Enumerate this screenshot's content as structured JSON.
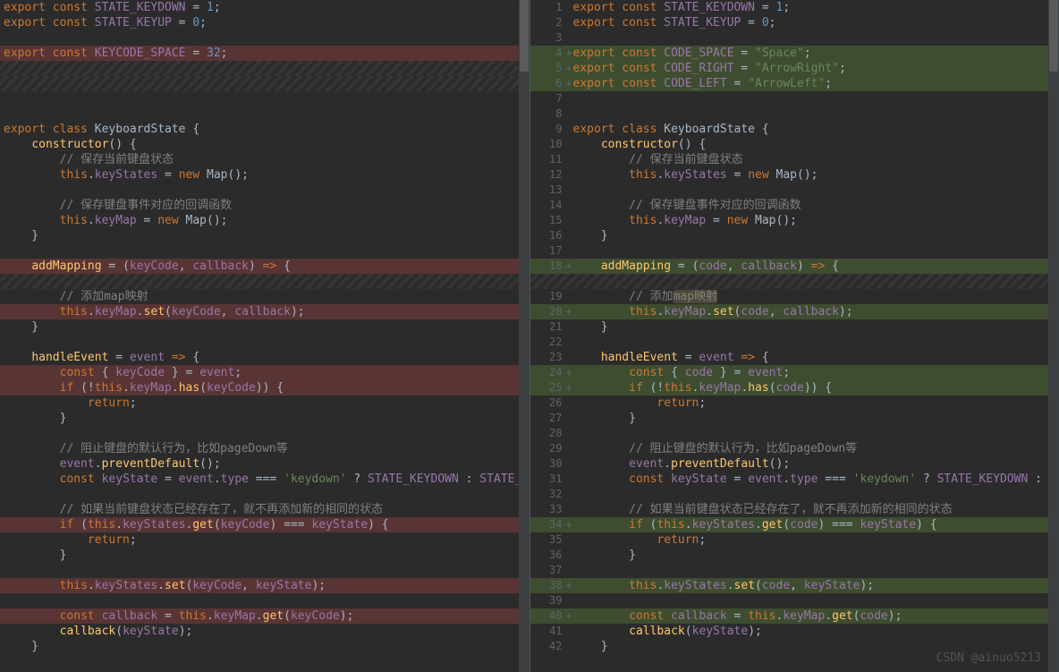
{
  "watermark": "CSDN @ainuo5213",
  "left": {
    "lines": [
      {
        "cls": "",
        "html": "<span class='kw'>export</span> <span class='kw'>const</span> <span class='prop'>STATE_KEYDOWN</span> = <span class='num'>1</span>;"
      },
      {
        "cls": "",
        "html": "<span class='kw'>export</span> <span class='kw'>const</span> <span class='prop'>STATE_KEYUP</span> = <span class='num'>0</span>;"
      },
      {
        "cls": "",
        "html": ""
      },
      {
        "cls": "del",
        "html": "<span class='kw'>export</span> <span class='kw'>const</span> <span class='prop'>KEYCODE_SPACE</span> = <span class='num'>32</span>;"
      },
      {
        "cls": "hatch",
        "html": ""
      },
      {
        "cls": "hatch",
        "html": ""
      },
      {
        "cls": "",
        "html": ""
      },
      {
        "cls": "",
        "html": ""
      },
      {
        "cls": "",
        "html": "<span class='kw'>export</span> <span class='kw'>class</span> <span class='cls'>KeyboardState</span> {"
      },
      {
        "cls": "",
        "html": "    <span class='fn'>constructor</span>() {"
      },
      {
        "cls": "",
        "html": "        <span class='cmt'>// 保存当前键盘状态</span>"
      },
      {
        "cls": "",
        "html": "        <span class='this'>this</span>.<span class='prop'>keyStates</span> = <span class='new'>new</span> Map();"
      },
      {
        "cls": "",
        "html": ""
      },
      {
        "cls": "",
        "html": "        <span class='cmt'>// 保存键盘事件对应的回调函数</span>"
      },
      {
        "cls": "",
        "html": "        <span class='this'>this</span>.<span class='prop'>keyMap</span> = <span class='new'>new</span> Map();"
      },
      {
        "cls": "",
        "html": "    }"
      },
      {
        "cls": "",
        "html": ""
      },
      {
        "cls": "del",
        "html": "    <span class='fn'>addMapping</span> = (<span class='prop'>keyCode</span>, <span class='prop'>callback</span>) <span class='kw'>=&gt;</span> {"
      },
      {
        "cls": "hatch",
        "html": ""
      },
      {
        "cls": "",
        "html": "        <span class='cmt'>// 添加map映射</span>"
      },
      {
        "cls": "del",
        "html": "        <span class='this'>this</span>.<span class='prop'>keyMap</span>.<span class='fn'>set</span>(<span class='prop'>keyCode</span>, <span class='prop'>callback</span>);"
      },
      {
        "cls": "",
        "html": "    }"
      },
      {
        "cls": "",
        "html": ""
      },
      {
        "cls": "",
        "html": "    <span class='fn'>handleEvent</span> = <span class='prop'>event</span> <span class='kw'>=&gt;</span> {"
      },
      {
        "cls": "del",
        "html": "        <span class='kw'>const</span> { <span class='prop'>keyCode</span> } = <span class='prop'>event</span>;"
      },
      {
        "cls": "del",
        "html": "        <span class='kw'>if</span> (!<span class='this'>this</span>.<span class='prop'>keyMap</span>.<span class='fn'>has</span>(<span class='prop'>keyCode</span>)) {"
      },
      {
        "cls": "",
        "html": "            <span class='kw'>return</span>;"
      },
      {
        "cls": "",
        "html": "        }"
      },
      {
        "cls": "",
        "html": ""
      },
      {
        "cls": "",
        "html": "        <span class='cmt'>// 阻止键盘的默认行为，比如pageDown等</span>"
      },
      {
        "cls": "",
        "html": "        <span class='prop'>event</span>.<span class='fn'>preventDefault</span>();"
      },
      {
        "cls": "",
        "html": "        <span class='kw'>const</span> <span class='prop'>keyState</span> = <span class='prop'>event</span>.<span class='prop'>type</span> === <span class='str'>'keydown'</span> ? <span class='prop'>STATE_KEYDOWN</span> : <span class='prop'>STATE_</span>"
      },
      {
        "cls": "",
        "html": ""
      },
      {
        "cls": "",
        "html": "        <span class='cmt'>// 如果当前键盘状态已经存在了，就不再添加新的相同的状态</span>"
      },
      {
        "cls": "del",
        "html": "        <span class='kw'>if</span> (<span class='this'>this</span>.<span class='prop'>keyStates</span>.<span class='fn'>get</span>(<span class='prop'>keyCode</span>) === <span class='prop'>keyState</span>) {"
      },
      {
        "cls": "",
        "html": "            <span class='kw'>return</span>;"
      },
      {
        "cls": "",
        "html": "        }"
      },
      {
        "cls": "",
        "html": ""
      },
      {
        "cls": "del",
        "html": "        <span class='this'>this</span>.<span class='prop'>keyStates</span>.<span class='fn'>set</span>(<span class='prop'>keyCode</span>, <span class='prop'>keyState</span>);"
      },
      {
        "cls": "",
        "html": ""
      },
      {
        "cls": "del",
        "html": "        <span class='kw'>const</span> <span class='prop'>callback</span> = <span class='this'>this</span>.<span class='prop'>keyMap</span>.<span class='fn'>get</span>(<span class='prop'>keyCode</span>);"
      },
      {
        "cls": "",
        "html": "        <span class='fn'>callback</span>(<span class='prop'>keyState</span>);"
      },
      {
        "cls": "",
        "html": "    }"
      }
    ]
  },
  "right": {
    "lines": [
      {
        "num": "1",
        "plus": false,
        "cls": "",
        "html": "<span class='kw'>export</span> <span class='kw'>const</span> <span class='prop'>STATE_KEYDOWN</span> = <span class='num'>1</span>;"
      },
      {
        "num": "2",
        "plus": false,
        "cls": "",
        "html": "<span class='kw'>export</span> <span class='kw'>const</span> <span class='prop'>STATE_KEYUP</span> = <span class='num'>0</span>;"
      },
      {
        "num": "3",
        "plus": false,
        "cls": "",
        "html": ""
      },
      {
        "num": "4",
        "plus": true,
        "cls": "add",
        "html": "<span class='kw'>export</span> <span class='kw'>const</span> <span class='prop'>CODE_SPACE</span> = <span class='str'>\"Space\"</span>;"
      },
      {
        "num": "5",
        "plus": true,
        "cls": "add",
        "html": "<span class='kw'>export</span> <span class='kw'>const</span> <span class='prop'>CODE_RIGHT</span> = <span class='str'>\"ArrowRight\"</span>;"
      },
      {
        "num": "6",
        "plus": true,
        "cls": "add",
        "html": "<span class='kw'>export</span> <span class='kw'>const</span> <span class='prop'>CODE_LEFT</span> = <span class='str'>\"ArrowLeft\"</span>;"
      },
      {
        "num": "7",
        "plus": false,
        "cls": "",
        "html": ""
      },
      {
        "num": "8",
        "plus": false,
        "cls": "",
        "html": ""
      },
      {
        "num": "9",
        "plus": false,
        "cls": "",
        "html": "<span class='kw'>export</span> <span class='kw'>class</span> <span class='cls'>KeyboardState</span> {"
      },
      {
        "num": "10",
        "plus": false,
        "cls": "",
        "html": "    <span class='fn'>constructor</span>() {"
      },
      {
        "num": "11",
        "plus": false,
        "cls": "",
        "html": "        <span class='cmt'>// 保存当前键盘状态</span>"
      },
      {
        "num": "12",
        "plus": false,
        "cls": "",
        "html": "        <span class='this'>this</span>.<span class='prop'>keyStates</span> = <span class='new'>new</span> Map();"
      },
      {
        "num": "13",
        "plus": false,
        "cls": "",
        "html": ""
      },
      {
        "num": "14",
        "plus": false,
        "cls": "",
        "html": "        <span class='cmt'>// 保存键盘事件对应的回调函数</span>"
      },
      {
        "num": "15",
        "plus": false,
        "cls": "",
        "html": "        <span class='this'>this</span>.<span class='prop'>keyMap</span> = <span class='new'>new</span> Map();"
      },
      {
        "num": "16",
        "plus": false,
        "cls": "",
        "html": "    }"
      },
      {
        "num": "17",
        "plus": false,
        "cls": "",
        "html": ""
      },
      {
        "num": "18",
        "plus": true,
        "cls": "add",
        "html": "    <span class='fn'>addMapping</span> = (<span class='prop'>code</span>, <span class='prop'>callback</span>) <span class='kw'>=&gt;</span> {"
      },
      {
        "num": "",
        "plus": false,
        "cls": "hatch",
        "html": ""
      },
      {
        "num": "19",
        "plus": false,
        "cls": "",
        "html": "        <span class='cmt'>// 添加<span class='hl-word'>map映射</span></span>"
      },
      {
        "num": "20",
        "plus": true,
        "cls": "add",
        "html": "        <span class='this'>this</span>.<span class='prop'>keyMap</span>.<span class='fn'>set</span>(<span class='prop'>code</span>, <span class='prop'>callback</span>);"
      },
      {
        "num": "21",
        "plus": false,
        "cls": "",
        "html": "    }"
      },
      {
        "num": "22",
        "plus": false,
        "cls": "",
        "html": ""
      },
      {
        "num": "23",
        "plus": false,
        "cls": "",
        "html": "    <span class='fn'>handleEvent</span> = <span class='prop'>event</span> <span class='kw'>=&gt;</span> {"
      },
      {
        "num": "24",
        "plus": true,
        "cls": "add",
        "html": "        <span class='kw'>const</span> { <span class='prop'>code</span> } = <span class='prop'>event</span>;"
      },
      {
        "num": "25",
        "plus": true,
        "cls": "add",
        "html": "        <span class='kw'>if</span> (!<span class='this'>this</span>.<span class='prop'>keyMap</span>.<span class='fn'>has</span>(<span class='prop'>code</span>)) {"
      },
      {
        "num": "26",
        "plus": false,
        "cls": "",
        "html": "            <span class='kw'>return</span>;"
      },
      {
        "num": "27",
        "plus": false,
        "cls": "",
        "html": "        }"
      },
      {
        "num": "28",
        "plus": false,
        "cls": "",
        "html": ""
      },
      {
        "num": "29",
        "plus": false,
        "cls": "",
        "html": "        <span class='cmt'>// 阻止键盘的默认行为，比如pageDown等</span>"
      },
      {
        "num": "30",
        "plus": false,
        "cls": "",
        "html": "        <span class='prop'>event</span>.<span class='fn'>preventDefault</span>();"
      },
      {
        "num": "31",
        "plus": false,
        "cls": "",
        "html": "        <span class='kw'>const</span> <span class='prop'>keyState</span> = <span class='prop'>event</span>.<span class='prop'>type</span> === <span class='str'>'keydown'</span> ? <span class='prop'>STATE_KEYDOWN</span> : <span class='prop'>S</span>"
      },
      {
        "num": "32",
        "plus": false,
        "cls": "",
        "html": ""
      },
      {
        "num": "33",
        "plus": false,
        "cls": "",
        "html": "        <span class='cmt'>// 如果当前键盘状态已经存在了，就不再添加新的相同的状态</span>"
      },
      {
        "num": "34",
        "plus": true,
        "cls": "add",
        "html": "        <span class='kw'>if</span> (<span class='this'>this</span>.<span class='prop'>keyStates</span>.<span class='fn'>get</span>(<span class='prop'>code</span>) === <span class='prop'>keyState</span>) {"
      },
      {
        "num": "35",
        "plus": false,
        "cls": "",
        "html": "            <span class='kw'>return</span>;"
      },
      {
        "num": "36",
        "plus": false,
        "cls": "",
        "html": "        }"
      },
      {
        "num": "37",
        "plus": false,
        "cls": "",
        "html": ""
      },
      {
        "num": "38",
        "plus": true,
        "cls": "add",
        "html": "        <span class='this'>this</span>.<span class='prop'>keyStates</span>.<span class='fn'>set</span>(<span class='prop'>code</span>, <span class='prop'>keyState</span>);"
      },
      {
        "num": "39",
        "plus": false,
        "cls": "",
        "html": ""
      },
      {
        "num": "40",
        "plus": true,
        "cls": "add",
        "html": "        <span class='kw'>const</span> <span class='prop'>callback</span> = <span class='this'>this</span>.<span class='prop'>keyMap</span>.<span class='fn'>get</span>(<span class='prop'>code</span>);"
      },
      {
        "num": "41",
        "plus": false,
        "cls": "",
        "html": "        <span class='fn'>callback</span>(<span class='prop'>keyState</span>);"
      },
      {
        "num": "42",
        "plus": false,
        "cls": "",
        "html": "    }"
      }
    ]
  }
}
